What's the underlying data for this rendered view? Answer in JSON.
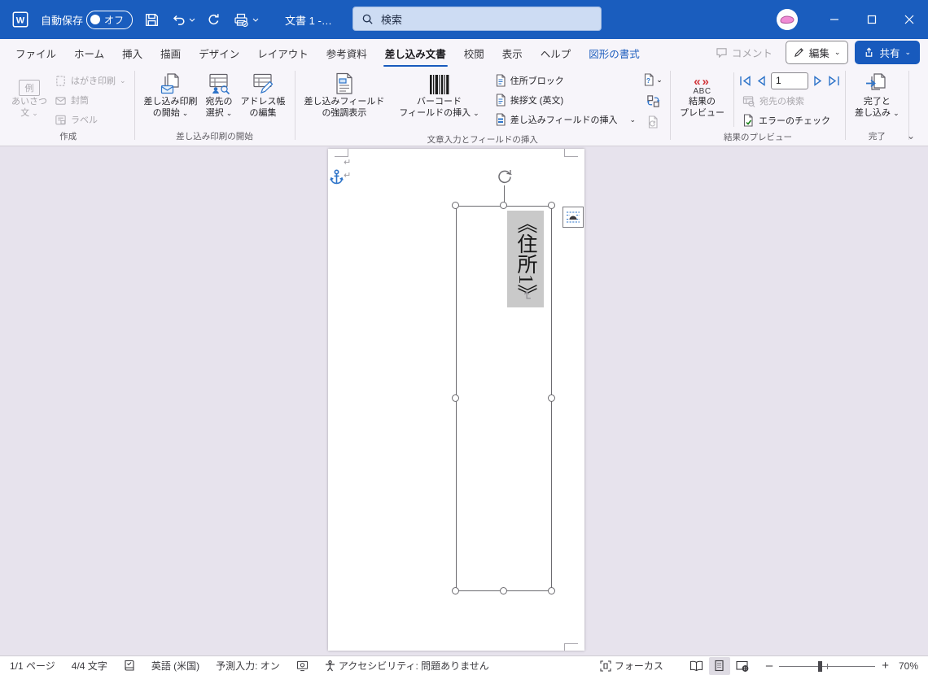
{
  "colors": {
    "titlebar": "#1a5dbe",
    "accent": "#185abd",
    "icon_blue": "#2e74c9",
    "preview_red": "#d13438",
    "check_green": "#107c10",
    "field_highlight": "#c9c9c9"
  },
  "titlebar": {
    "autosave_label": "自動保存",
    "autosave_state": "オフ",
    "doc_title": "文書 1 -…",
    "search": "検索"
  },
  "tabs": {
    "items": [
      {
        "label": "ファイル"
      },
      {
        "label": "ホーム"
      },
      {
        "label": "挿入"
      },
      {
        "label": "描画"
      },
      {
        "label": "デザイン"
      },
      {
        "label": "レイアウト"
      },
      {
        "label": "参考資料"
      },
      {
        "label": "差し込み文書"
      },
      {
        "label": "校閲"
      },
      {
        "label": "表示"
      },
      {
        "label": "ヘルプ"
      },
      {
        "label": "図形の書式"
      }
    ],
    "comments": "コメント",
    "editing": "編集",
    "share": "共有"
  },
  "ribbon": {
    "create": {
      "label": "作成",
      "greeting_icon_text": "例",
      "greeting_l1": "あいさつ",
      "greeting_l2": "文",
      "hagaki": "はがき印刷",
      "envelope": "封筒",
      "labels": "ラベル"
    },
    "start": {
      "label": "差し込み印刷の開始",
      "start_l1": "差し込み印刷",
      "start_l2": "の開始",
      "recipients_l1": "宛先の",
      "recipients_l2": "選択",
      "editlist_l1": "アドレス帳",
      "editlist_l2": "の編集"
    },
    "fields": {
      "label": "文章入力とフィールドの挿入",
      "highlight_l1": "差し込みフィールド",
      "highlight_l2": "の強調表示",
      "barcode_l1": "バーコード",
      "barcode_l2": "フィールドの挿入",
      "address_block": "住所ブロック",
      "greeting_line": "挨拶文 (英文)",
      "insert_field": "差し込みフィールドの挿入"
    },
    "preview": {
      "label": "結果のプレビュー",
      "preview_l1": "結果の",
      "preview_l2": "プレビュー",
      "icon_left": "«",
      "icon_right": "»",
      "abc": "ABC",
      "record_number": "1",
      "find_recipient": "宛先の検索",
      "check_errors": "エラーのチェック"
    },
    "finish": {
      "label": "完了",
      "finish_l1": "完了と",
      "finish_l2": "差し込み"
    }
  },
  "document": {
    "merge_field": "《住所1》",
    "paragraph_mark": "↵"
  },
  "statusbar": {
    "page": "1/1 ページ",
    "chars": "4/4 文字",
    "language": "英語 (米国)",
    "prediction": "予測入力: オン",
    "accessibility": "アクセシビリティ: 問題ありません",
    "focus": "フォーカス",
    "zoom": "70%"
  }
}
